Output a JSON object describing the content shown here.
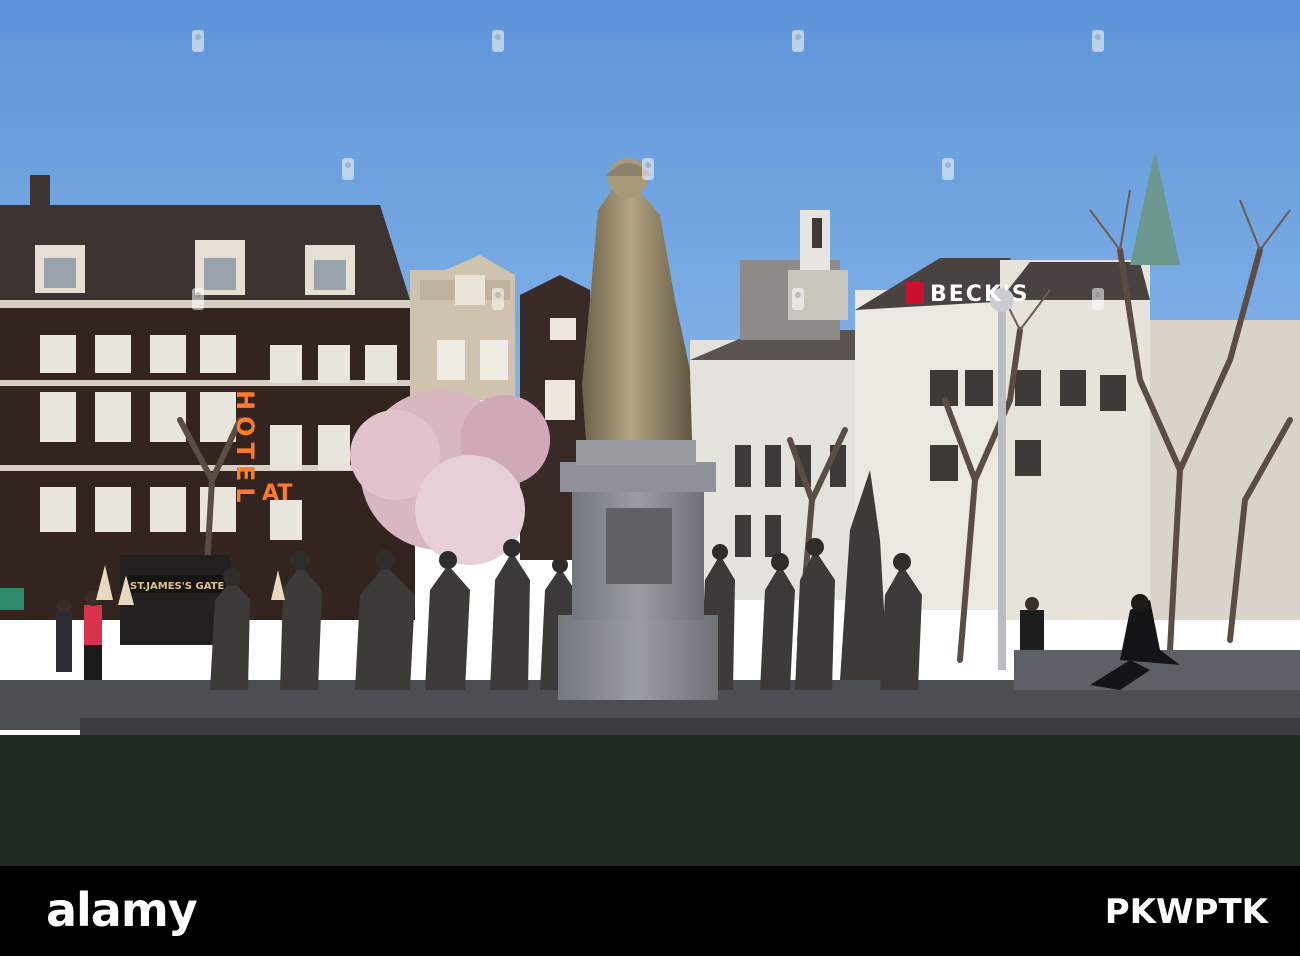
{
  "scene": {
    "description_free": true,
    "sky_color": "#6ea4e0",
    "signs": {
      "hotel_vertical": "HOTEL",
      "hotel_horizontal": "AT",
      "brewery": "BECK'S",
      "pub": "ST.JAMES'S GATE"
    }
  },
  "footer": {
    "logo_text": "alamy",
    "image_id": "PKWPTK"
  },
  "colors": {
    "footer": "#000000",
    "lawn": "#1f2a21",
    "statue_bronze": "#a39676",
    "plinth": "#8a8d92",
    "brick_dark": "#3a2a26",
    "hotel_orange": "#ff7a2a"
  }
}
